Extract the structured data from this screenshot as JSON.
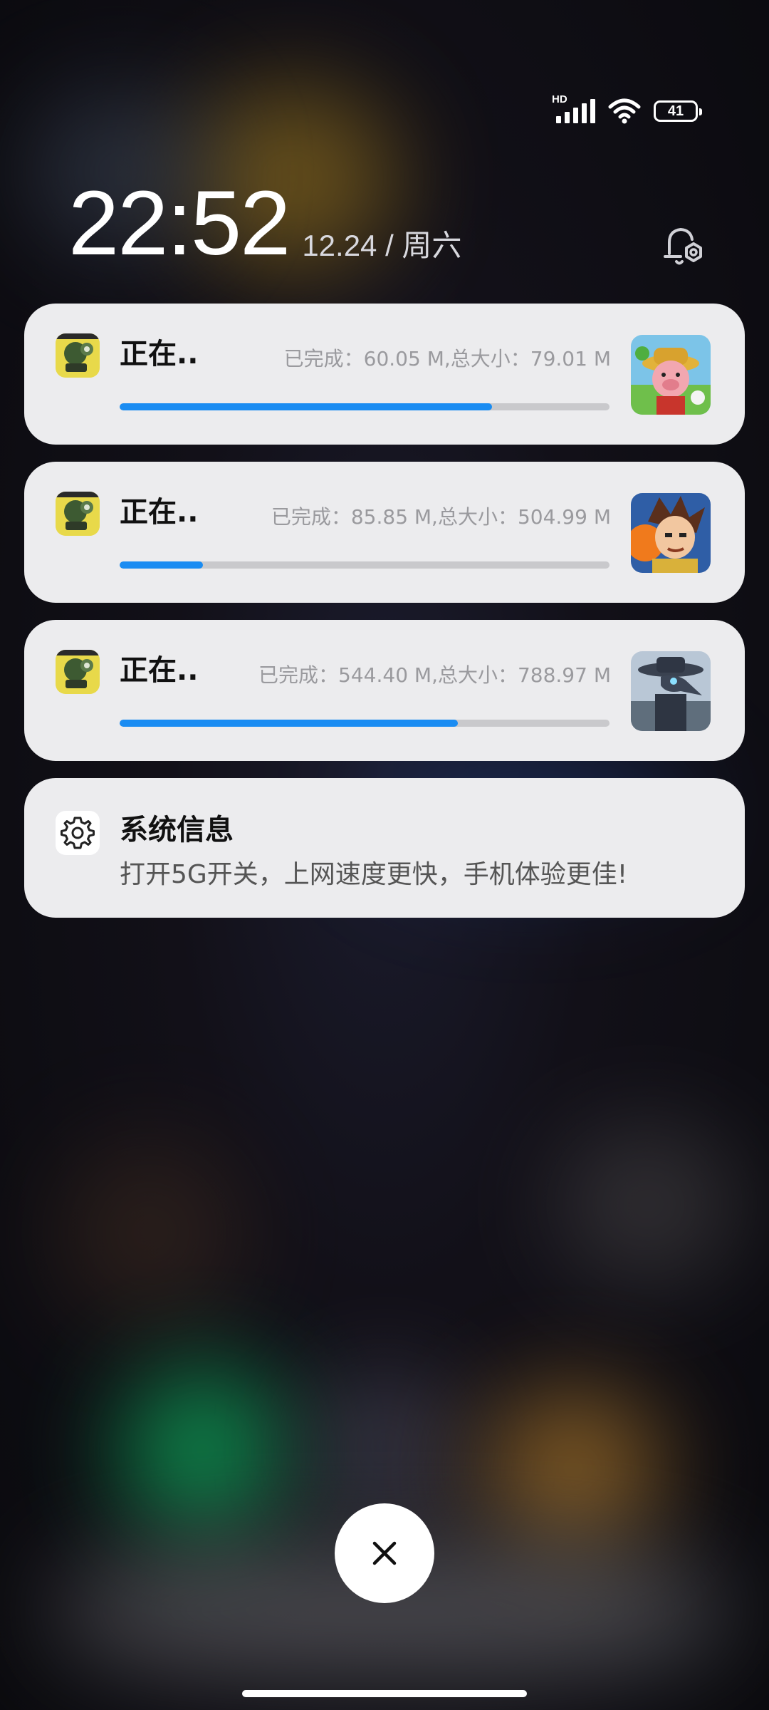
{
  "status_bar": {
    "network_label": "HD",
    "battery_level": "41",
    "icons": [
      "hd-signal-icon",
      "wifi-icon",
      "battery-icon"
    ]
  },
  "lockscreen": {
    "time": "22:52",
    "date": "12.24 / 周六",
    "notification_settings_icon": "bell-settings-icon"
  },
  "notifications": [
    {
      "title": "正在..",
      "progress_text": "已完成：60.05 M,总大小：79.01 M",
      "progress": 0.76,
      "app_icon": "turret-game-icon",
      "thumbnail": "pig-farmer-game-thumbnail"
    },
    {
      "title": "正在..",
      "progress_text": "已完成：85.85 M,总大小：504.99 M",
      "progress": 0.17,
      "app_icon": "turret-game-icon",
      "thumbnail": "hero-boy-game-thumbnail"
    },
    {
      "title": "正在..",
      "progress_text": "已完成：544.40 M,总大小：788.97 M",
      "progress": 0.69,
      "app_icon": "turret-game-icon",
      "thumbnail": "plague-doctor-game-thumbnail"
    }
  ],
  "system_info": {
    "title": "系统信息",
    "body": "打开5G开关，上网速度更快，手机体验更佳!",
    "icon": "gear-icon"
  },
  "close_icon": "close-icon",
  "colors": {
    "progress_fill": "#1a8cf2",
    "card_bg": "#ececee"
  }
}
